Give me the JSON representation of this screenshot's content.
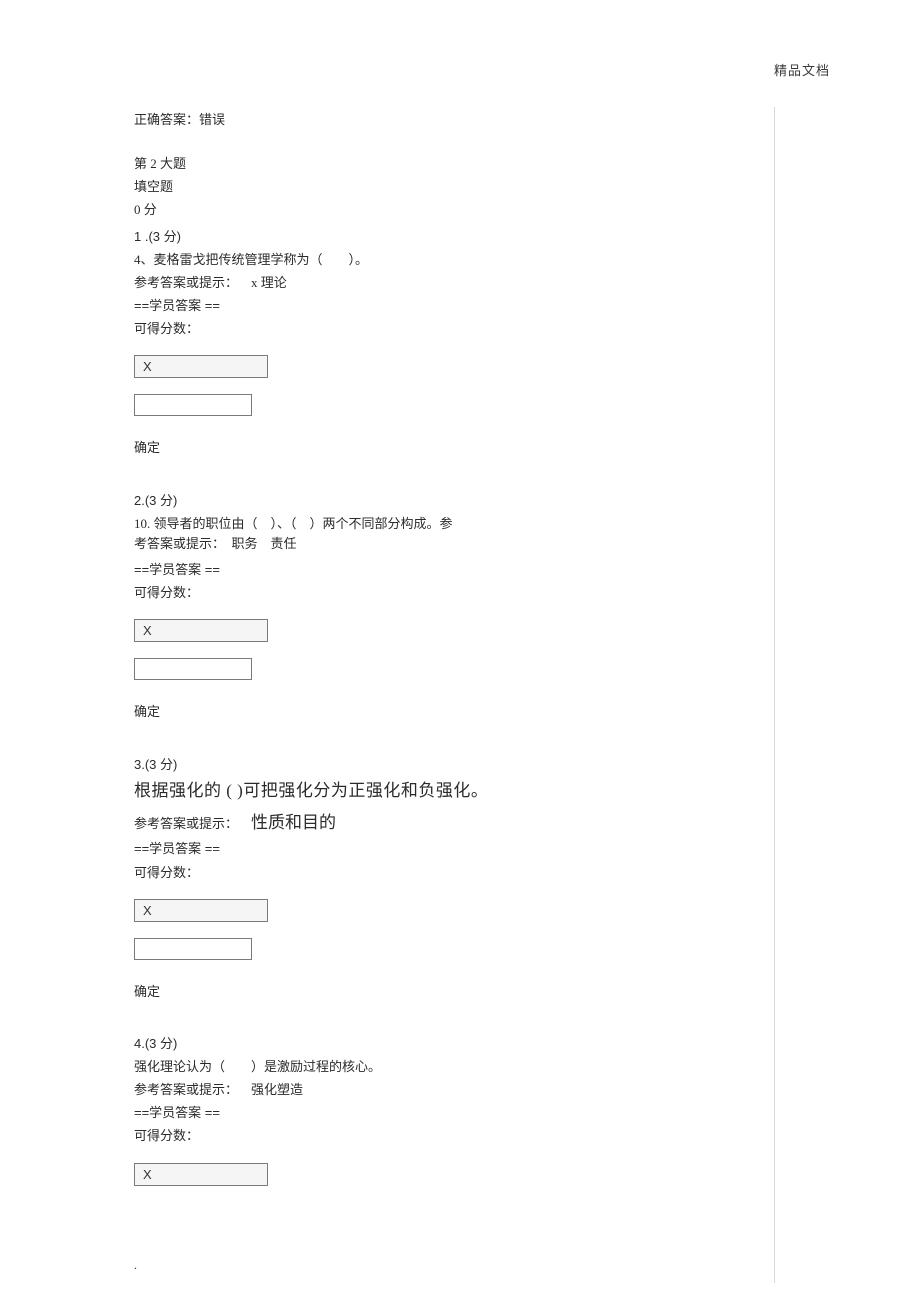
{
  "header": {
    "watermark": "精品文档"
  },
  "top": {
    "correct_line": "正确答案：错误"
  },
  "section": {
    "title": "第 2 大题",
    "type": "填空题",
    "score": "0  分"
  },
  "questions": [
    {
      "num": "1 .(3 分)",
      "body": "4、麦格雷戈把传统管理学称为（　　）。",
      "hint_label": "参考答案或提示：",
      "hint_answer": "x 理论",
      "student_label": "==学员答案 ==",
      "score_label": "可得分数：",
      "input1": "X",
      "confirm": "确定"
    },
    {
      "num": "2.(3 分)",
      "body": "10. 领导者的职位由（　）、（　）两个不同部分构成。参考答案或提示：　职务　责任",
      "student_label": "==学员答案 ==",
      "score_label": "可得分数：",
      "input1": "X",
      "confirm": "确定"
    },
    {
      "num": "3.(3 分)",
      "body_big": "根据强化的 ( )可把强化分为正强化和负强化。",
      "hint_label": "参考答案或提示：",
      "hint_answer_big": "性质和目的",
      "student_label": "==学员答案 ==",
      "score_label": "可得分数：",
      "input1": "X",
      "confirm": "确定"
    },
    {
      "num": "4.(3 分)",
      "body": "强化理论认为（　　）是激励过程的核心。",
      "hint_label": "参考答案或提示：",
      "hint_answer": "强化塑造",
      "student_label": "==学员答案 ==",
      "score_label": "可得分数：",
      "input1": "X"
    }
  ],
  "footer_dot": "."
}
